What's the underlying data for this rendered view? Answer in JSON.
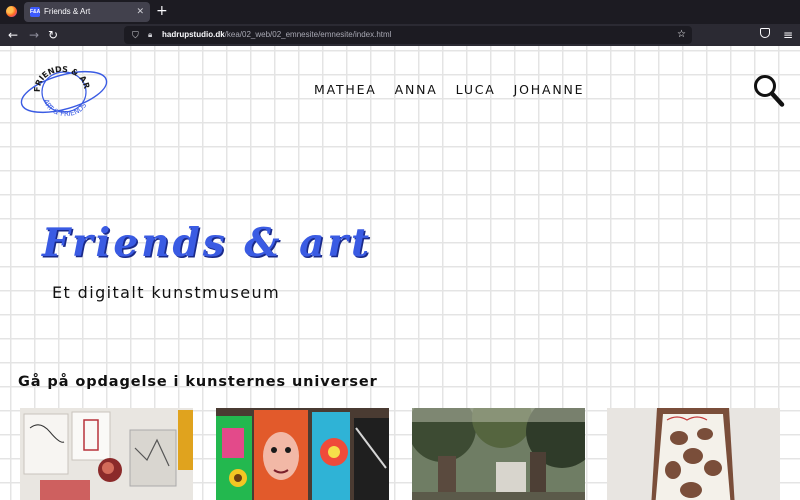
{
  "browser": {
    "tab": {
      "favicon_text": "F&A",
      "title": "Friends & Art",
      "close_icon": "close-icon"
    },
    "new_tab_icon": "plus-icon",
    "nav": {
      "back_icon": "arrow-left-icon",
      "forward_icon": "arrow-right-icon",
      "reload_icon": "reload-icon"
    },
    "url": {
      "host": "hadrupstudio.dk",
      "path": "/kea/02_web/02_emnesite/emnesite/index.html"
    },
    "toolbar_icons": [
      "shield-icon",
      "lock-icon",
      "star-icon",
      "pocket-icon",
      "extensions-icon"
    ]
  },
  "site": {
    "logo": {
      "top_text": "FRIENDS & ART",
      "bottom_text": "ART & FRIENDS",
      "accent_color": "#3a5be3"
    },
    "nav": [
      "MATHEA",
      "ANNA",
      "LUCA",
      "JOHANNE"
    ],
    "search_icon": "magnifier-icon",
    "hero": {
      "title": "Friends & art",
      "subtitle": "Et digitalt kunstmuseum"
    },
    "section_title": "Gå på opdagelse i kunsternes universer",
    "artist_cards": [
      "artwork-wall-collage",
      "artwork-colorful-paintings",
      "artwork-outdoor-trees",
      "artwork-crochet-garment"
    ]
  },
  "colors": {
    "accent": "#3a5be3",
    "grid": "#e4e4e4",
    "chrome_dark": "#1c1b22",
    "chrome_mid": "#2b2a33"
  }
}
